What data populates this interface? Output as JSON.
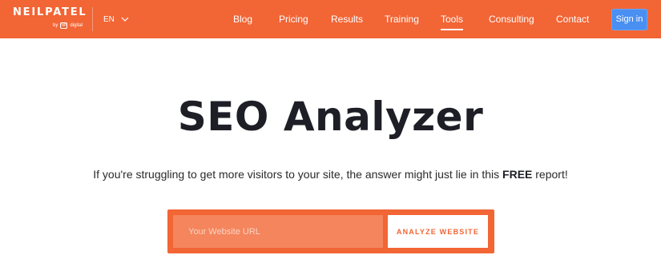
{
  "brand": {
    "name": "NEILPATEL",
    "by_text": "by",
    "sub_brand_mark": "NP",
    "sub_brand_name": "digital",
    "accent_color": "#f26535"
  },
  "header": {
    "language": "EN",
    "language_icon": "chevron-down-icon",
    "nav": [
      {
        "label": "Blog",
        "active": false
      },
      {
        "label": "Pricing",
        "active": false
      },
      {
        "label": "Results",
        "active": false
      },
      {
        "label": "Training",
        "active": false
      },
      {
        "label": "Tools",
        "active": true
      },
      {
        "label": "Consulting",
        "active": false
      },
      {
        "label": "Contact",
        "active": false
      }
    ],
    "signin_label": "Sign in",
    "signin_color": "#4a8ff2"
  },
  "hero": {
    "title": "SEO Analyzer",
    "subtitle_before": "If you're struggling to get more visitors to your site, the answer might just lie in this ",
    "subtitle_bold": "FREE",
    "subtitle_after": " report!"
  },
  "form": {
    "url_placeholder": "Your Website URL",
    "url_value": "",
    "submit_label": "ANALYZE WEBSITE"
  }
}
